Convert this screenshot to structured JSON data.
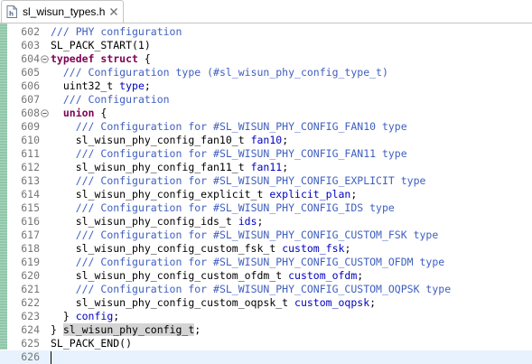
{
  "tab": {
    "title": "sl_wisun_types.h",
    "file_icon": "header-file-icon",
    "close_icon": "close-icon"
  },
  "editor": {
    "first_line": 602,
    "lines": [
      {
        "n": "602",
        "fold": false,
        "tokens": [
          {
            "c": "cm",
            "t": "/// PHY configuration"
          }
        ]
      },
      {
        "n": "603",
        "fold": false,
        "tokens": [
          {
            "c": "",
            "t": "SL_PACK_START(1)"
          }
        ]
      },
      {
        "n": "604",
        "fold": true,
        "tokens": [
          {
            "c": "kw",
            "t": "typedef"
          },
          {
            "c": "",
            "t": " "
          },
          {
            "c": "kw",
            "t": "struct"
          },
          {
            "c": "",
            "t": " {"
          }
        ]
      },
      {
        "n": "605",
        "fold": false,
        "tokens": [
          {
            "c": "",
            "t": "  "
          },
          {
            "c": "cm",
            "t": "/// Configuration type (#sl_wisun_phy_config_type_t)"
          }
        ]
      },
      {
        "n": "606",
        "fold": false,
        "tokens": [
          {
            "c": "",
            "t": "  uint32_t "
          },
          {
            "c": "fld",
            "t": "type"
          },
          {
            "c": "",
            "t": ";"
          }
        ]
      },
      {
        "n": "607",
        "fold": false,
        "tokens": [
          {
            "c": "",
            "t": "  "
          },
          {
            "c": "cm",
            "t": "/// Configuration"
          }
        ]
      },
      {
        "n": "608",
        "fold": true,
        "tokens": [
          {
            "c": "",
            "t": "  "
          },
          {
            "c": "kw",
            "t": "union"
          },
          {
            "c": "",
            "t": " {"
          }
        ]
      },
      {
        "n": "609",
        "fold": false,
        "tokens": [
          {
            "c": "",
            "t": "    "
          },
          {
            "c": "cm",
            "t": "/// Configuration for #SL_WISUN_PHY_CONFIG_FAN10 type"
          }
        ]
      },
      {
        "n": "610",
        "fold": false,
        "tokens": [
          {
            "c": "",
            "t": "    sl_wisun_phy_config_fan10_t "
          },
          {
            "c": "fld",
            "t": "fan10"
          },
          {
            "c": "",
            "t": ";"
          }
        ]
      },
      {
        "n": "611",
        "fold": false,
        "tokens": [
          {
            "c": "",
            "t": "    "
          },
          {
            "c": "cm",
            "t": "/// Configuration for #SL_WISUN_PHY_CONFIG_FAN11 type"
          }
        ]
      },
      {
        "n": "612",
        "fold": false,
        "tokens": [
          {
            "c": "",
            "t": "    sl_wisun_phy_config_fan11_t "
          },
          {
            "c": "fld",
            "t": "fan11"
          },
          {
            "c": "",
            "t": ";"
          }
        ]
      },
      {
        "n": "613",
        "fold": false,
        "tokens": [
          {
            "c": "",
            "t": "    "
          },
          {
            "c": "cm",
            "t": "/// Configuration for #SL_WISUN_PHY_CONFIG_EXPLICIT type"
          }
        ]
      },
      {
        "n": "614",
        "fold": false,
        "tokens": [
          {
            "c": "",
            "t": "    sl_wisun_phy_config_explicit_t "
          },
          {
            "c": "fld",
            "t": "explicit_plan"
          },
          {
            "c": "",
            "t": ";"
          }
        ]
      },
      {
        "n": "615",
        "fold": false,
        "tokens": [
          {
            "c": "",
            "t": "    "
          },
          {
            "c": "cm",
            "t": "/// Configuration for #SL_WISUN_PHY_CONFIG_IDS type"
          }
        ]
      },
      {
        "n": "616",
        "fold": false,
        "tokens": [
          {
            "c": "",
            "t": "    sl_wisun_phy_config_ids_t "
          },
          {
            "c": "fld",
            "t": "ids"
          },
          {
            "c": "",
            "t": ";"
          }
        ]
      },
      {
        "n": "617",
        "fold": false,
        "tokens": [
          {
            "c": "",
            "t": "    "
          },
          {
            "c": "cm",
            "t": "/// Configuration for #SL_WISUN_PHY_CONFIG_CUSTOM_FSK type"
          }
        ]
      },
      {
        "n": "618",
        "fold": false,
        "tokens": [
          {
            "c": "",
            "t": "    sl_wisun_phy_config_custom_fsk_t "
          },
          {
            "c": "fld",
            "t": "custom_fsk"
          },
          {
            "c": "",
            "t": ";"
          }
        ]
      },
      {
        "n": "619",
        "fold": false,
        "tokens": [
          {
            "c": "",
            "t": "    "
          },
          {
            "c": "cm",
            "t": "/// Configuration for #SL_WISUN_PHY_CONFIG_CUSTOM_OFDM type"
          }
        ]
      },
      {
        "n": "620",
        "fold": false,
        "tokens": [
          {
            "c": "",
            "t": "    sl_wisun_phy_config_custom_ofdm_t "
          },
          {
            "c": "fld",
            "t": "custom_ofdm"
          },
          {
            "c": "",
            "t": ";"
          }
        ]
      },
      {
        "n": "621",
        "fold": false,
        "tokens": [
          {
            "c": "",
            "t": "    "
          },
          {
            "c": "cm",
            "t": "/// Configuration for #SL_WISUN_PHY_CONFIG_CUSTOM_OQPSK type"
          }
        ]
      },
      {
        "n": "622",
        "fold": false,
        "tokens": [
          {
            "c": "",
            "t": "    sl_wisun_phy_config_custom_oqpsk_t "
          },
          {
            "c": "fld",
            "t": "custom_oqpsk"
          },
          {
            "c": "",
            "t": ";"
          }
        ]
      },
      {
        "n": "623",
        "fold": false,
        "tokens": [
          {
            "c": "",
            "t": "  } "
          },
          {
            "c": "fld",
            "t": "config"
          },
          {
            "c": "",
            "t": ";"
          }
        ]
      },
      {
        "n": "624",
        "fold": false,
        "tokens": [
          {
            "c": "",
            "t": "} "
          },
          {
            "c": "hl",
            "t": "sl_wisun_phy_config_t"
          },
          {
            "c": "",
            "t": ";"
          }
        ]
      },
      {
        "n": "625",
        "fold": false,
        "tokens": [
          {
            "c": "",
            "t": "SL_PACK_END()"
          }
        ]
      },
      {
        "n": "626",
        "fold": false,
        "current": true,
        "tokens": []
      }
    ]
  },
  "colors": {
    "keyword": "#7f0055",
    "comment": "#3f5fbf",
    "field": "#0000c0",
    "line_number": "#767676",
    "current_line": "#e8f2fe",
    "quick_diff": "#8fc7a8"
  }
}
